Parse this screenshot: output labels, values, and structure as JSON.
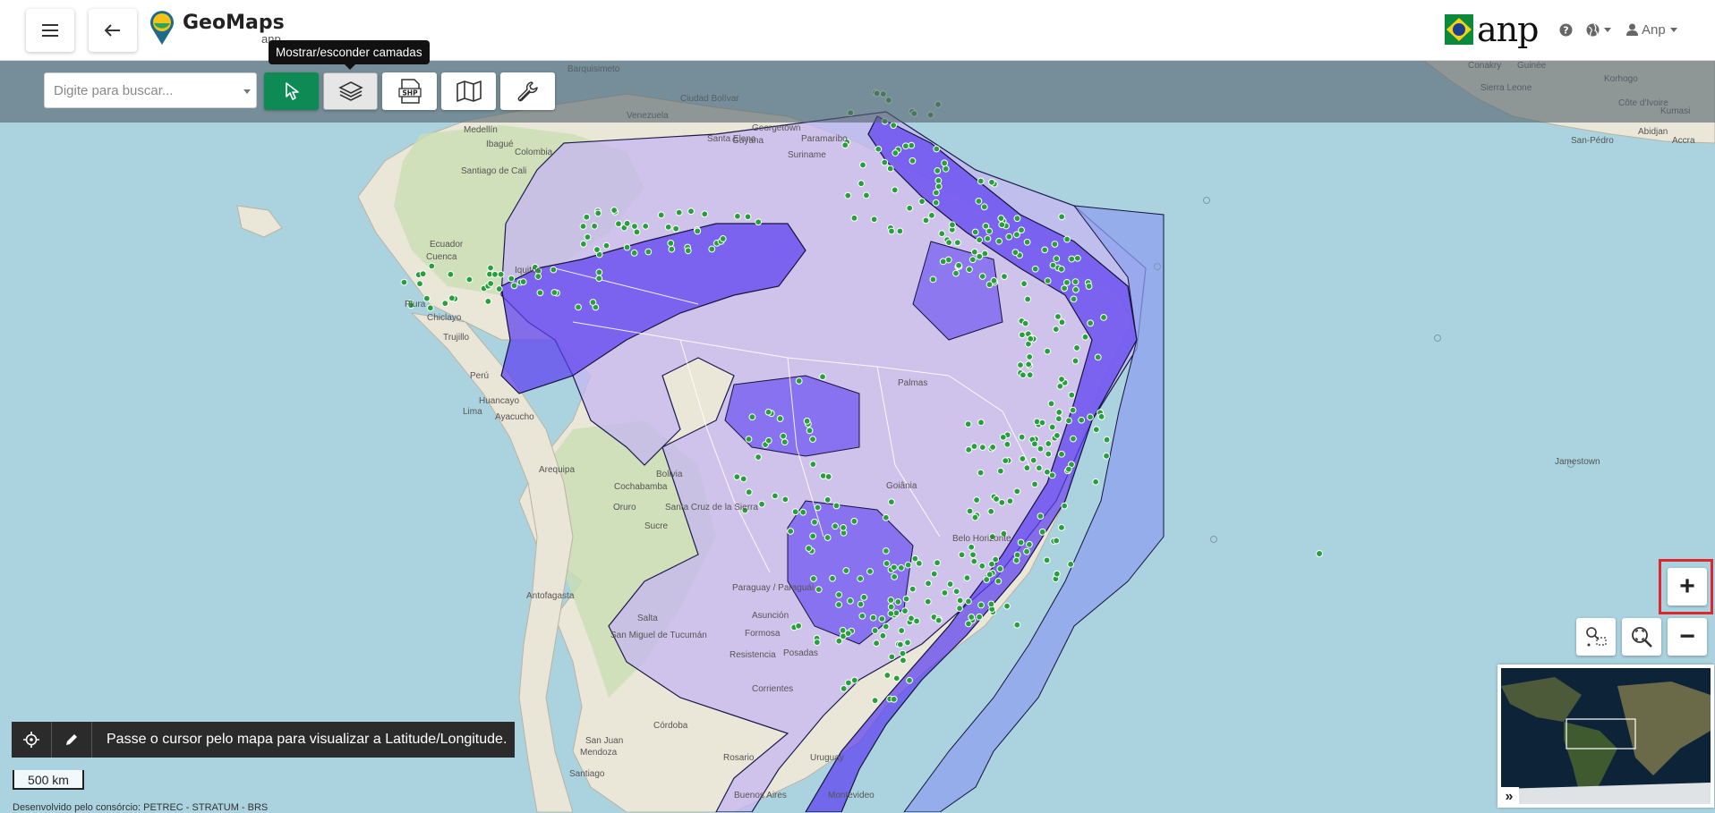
{
  "app": {
    "brand": "GeoMaps",
    "brand_sub": "anp",
    "org_logo_text": "anp"
  },
  "header": {
    "menu_icon": "hamburger-icon",
    "back_icon": "arrow-left-icon",
    "help_icon": "question-circle-icon",
    "language_icon": "globe-icon",
    "user_icon": "user-icon",
    "user_label": "Anp"
  },
  "toolbar": {
    "search_placeholder": "Digite para buscar...",
    "tools": [
      {
        "name": "select",
        "icon": "cursor-icon"
      },
      {
        "name": "layers",
        "icon": "layers-icon"
      },
      {
        "name": "shp",
        "icon": "shp-file-icon"
      },
      {
        "name": "basemap",
        "icon": "map-icon"
      },
      {
        "name": "tools",
        "icon": "wrench-icon"
      }
    ],
    "tooltip": "Mostrar/esconder camadas",
    "shp_label": "SHP"
  },
  "zoom": {
    "in_label": "+",
    "out_label": "−"
  },
  "coords": {
    "message": "Passe o cursor pelo mapa para visualizar a Latitude/Longitude."
  },
  "scale_label": "500 km",
  "credit": "Desenvolvido pelo consórcio: PETREC - STRATUM - BRS",
  "minimap_toggle": "»",
  "map_labels": [
    "Guyana",
    "Suriname",
    "Venezuela",
    "Colombia",
    "Medellín",
    "Ibagué",
    "Santiago de Cali",
    "Ecuador",
    "Cuenca",
    "Iquitos",
    "Piura",
    "Chiclayo",
    "Trujillo",
    "Perú",
    "Huancayo",
    "Lima",
    "Ayacucho",
    "Arequipa",
    "Bolivia",
    "Cochabamba",
    "Oruro",
    "Santa Cruz de la Sierra",
    "Sucre",
    "Antofagasta",
    "Paraguay / Paraguái",
    "Asunción",
    "San Miguel de Tucumán",
    "Salta",
    "Resistencia",
    "Formosa",
    "Posadas",
    "Corrientes",
    "Córdoba",
    "Mendoza",
    "San Juan",
    "Santiago",
    "Rosario",
    "Buenos Aires",
    "Montevideo",
    "Uruguay",
    "Belo Horizonte",
    "Goiânia",
    "Palmas",
    "Jamestown",
    "Côte d'Ivoire",
    "Accra",
    "Abidjan",
    "San-Pédro",
    "Korhogo",
    "Kumasi",
    "Sierra Leone",
    "Guinée",
    "Conakry",
    "Barquisimeto",
    "Ciudad Bolívar",
    "Santa Elena",
    "Georgetown",
    "Paramaribo"
  ]
}
